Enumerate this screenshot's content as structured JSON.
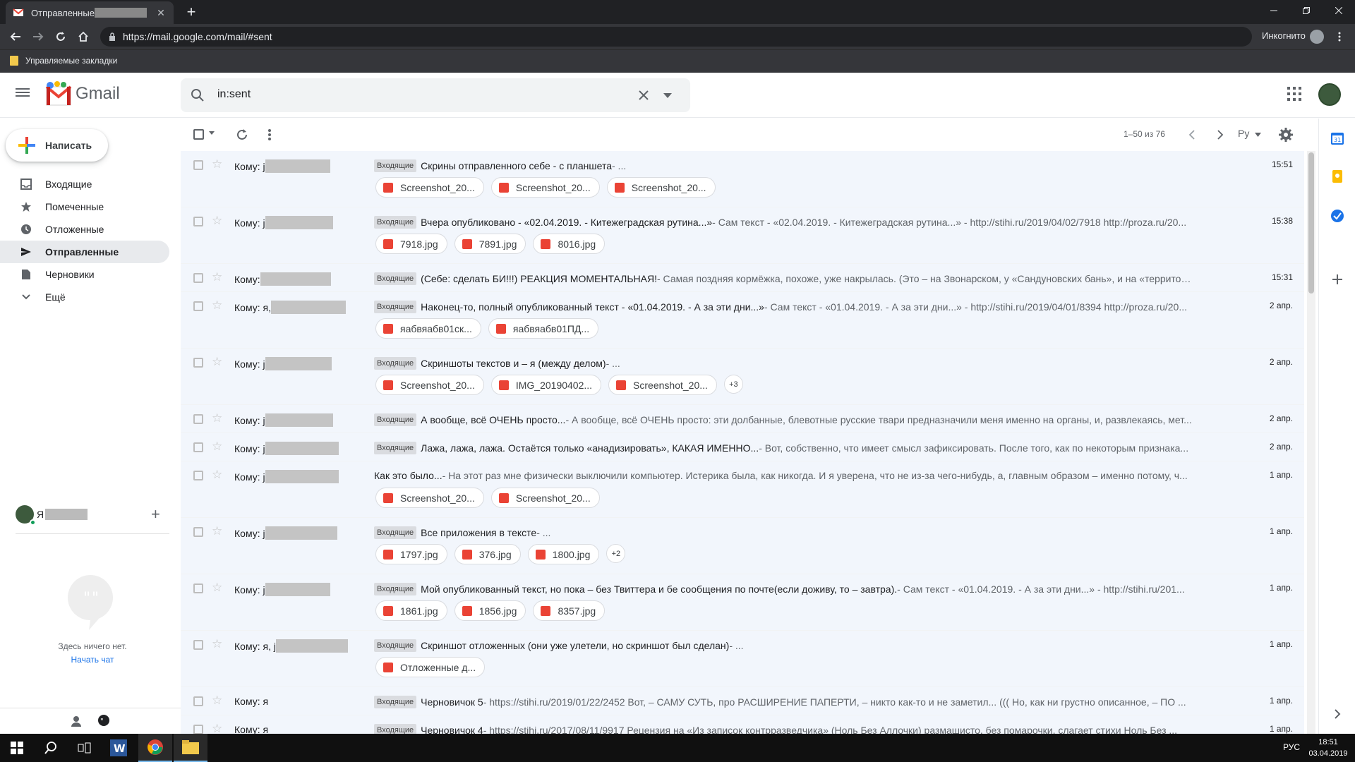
{
  "browser": {
    "tab_title": "Отправленные - j",
    "url": "https://mail.google.com/mail/#sent",
    "incognito_label": "Инкогнито",
    "bookmark_label": "Управляемые закладки"
  },
  "gmail": {
    "logo_text": "Gmail",
    "search_value": "in:sent",
    "compose_label": "Написать",
    "nav": [
      {
        "label": "Входящие",
        "icon": "inbox-icon"
      },
      {
        "label": "Помеченные",
        "icon": "star-icon"
      },
      {
        "label": "Отложенные",
        "icon": "clock-icon"
      },
      {
        "label": "Отправленные",
        "icon": "send-icon",
        "active": true
      },
      {
        "label": "Черновики",
        "icon": "draft-icon"
      },
      {
        "label": "Ещё",
        "icon": "chevron-down-icon"
      }
    ],
    "hangouts_user": "Я",
    "hangouts_empty_text": "Здесь ничего нет.",
    "hangouts_start_chat": "Начать чат",
    "pager_text": "1–50 из 76",
    "lang_label": "Ру"
  },
  "emails": [
    {
      "sender": "Кому: j",
      "label": "Входящие",
      "subject": "Скрины отправленного себе - с планшета",
      "snippet": " - ...",
      "date": "15:51",
      "attachments": [
        {
          "name": "Screenshot_20...",
          "type": "image"
        },
        {
          "name": "Screenshot_20...",
          "type": "image"
        },
        {
          "name": "Screenshot_20...",
          "type": "image"
        }
      ]
    },
    {
      "sender": "Кому: j",
      "label": "Входящие",
      "subject": "Вчера опубликовано - «02.04.2019. - Китежеградская рутина...»",
      "snippet": " - Сам текст - «02.04.2019. - Китежеградская рутина...» - http://stihi.ru/2019/04/02/7918 http://proza.ru/20...",
      "date": "15:38",
      "attachments": [
        {
          "name": "7918.jpg",
          "type": "image"
        },
        {
          "name": "7891.jpg",
          "type": "image"
        },
        {
          "name": "8016.jpg",
          "type": "image"
        }
      ]
    },
    {
      "sender": "Кому:",
      "label": "Входящие",
      "subject": "(Себе: сделать БИ!!!) РЕАКЦИЯ МОМЕНТАЛЬНАЯ!",
      "snippet": " - Самая поздняя кормёжка, похоже, уже накрылась. (Это – на Звонарском, у «Сандуновских бань», и на «территори...",
      "date": "15:31",
      "attachments": []
    },
    {
      "sender": "Кому: я,",
      "label": "Входящие",
      "subject": "Наконец-то, полный опубликованный текст - «01.04.2019. - А за эти дни...»",
      "snippet": " - Сам текст - «01.04.2019. - А за эти дни...» - http://stihi.ru/2019/04/01/8394 http://proza.ru/20...",
      "date": "2 апр.",
      "attachments": [
        {
          "name": "яабвяабв01ск...",
          "type": "image"
        },
        {
          "name": "яабвяабв01ПД...",
          "type": "pdf"
        }
      ]
    },
    {
      "sender": "Кому: j",
      "label": "Входящие",
      "subject": "Скриншоты текстов и – я (между делом)",
      "snippet": " - ...",
      "date": "2 апр.",
      "attachments": [
        {
          "name": "Screenshot_20...",
          "type": "image"
        },
        {
          "name": "IMG_20190402...",
          "type": "image"
        },
        {
          "name": "Screenshot_20...",
          "type": "image"
        }
      ],
      "more": "+3"
    },
    {
      "sender": "Кому: j",
      "label": "Входящие",
      "subject": "А вообще, всё ОЧЕНЬ просто...",
      "snippet": " - А вообще, всё ОЧЕНЬ просто: эти долбанные, блевотные русские твари предназначили меня именно на органы, и, развлекаясь, мет...",
      "date": "2 апр.",
      "attachments": []
    },
    {
      "sender": "Кому: j",
      "label": "Входящие",
      "subject": "Лажа, лажа, лажа. Остаётся только «анадизировать», КАКАЯ ИМЕННО...",
      "snippet": " - Вот, собственно, что имеет смысл зафиксировать. После того, как по некоторым признака...",
      "date": "2 апр.",
      "attachments": []
    },
    {
      "sender": "Кому: j",
      "label": "",
      "subject": "Как это было...",
      "snippet": " - На этот раз мне физически выключили компьютер. Истерика была, как никогда. И я уверена, что не из-за чего-нибудь, а, главным образом – именно потому, ч...",
      "date": "1 апр.",
      "attachments": [
        {
          "name": "Screenshot_20...",
          "type": "image"
        },
        {
          "name": "Screenshot_20...",
          "type": "image"
        }
      ]
    },
    {
      "sender": "Кому: j",
      "label": "Входящие",
      "subject": "Все приложения в тексте",
      "snippet": " - ...",
      "date": "1 апр.",
      "attachments": [
        {
          "name": "1797.jpg",
          "type": "image"
        },
        {
          "name": "376.jpg",
          "type": "image"
        },
        {
          "name": "1800.jpg",
          "type": "image"
        }
      ],
      "more": "+2"
    },
    {
      "sender": "Кому: j",
      "label": "Входящие",
      "subject": "Мой опубликованный текст, но пока – без Твиттера и бе сообщения по почте(если доживу, то – завтра).",
      "snippet": " - Сам текст - «01.04.2019. - А за эти дни...» - http://stihi.ru/201...",
      "date": "1 апр.",
      "attachments": [
        {
          "name": "1861.jpg",
          "type": "image"
        },
        {
          "name": "1856.jpg",
          "type": "image"
        },
        {
          "name": "8357.jpg",
          "type": "image"
        }
      ]
    },
    {
      "sender": "Кому: я, j",
      "label": "Входящие",
      "subject": "Скриншот отложенных (они уже улетели, но скриншот был сделан)",
      "snippet": " - ...",
      "date": "1 апр.",
      "attachments": [
        {
          "name": "Отложенные д...",
          "type": "image"
        }
      ]
    },
    {
      "sender": "Кому: я",
      "label": "Входящие",
      "subject": "Черновичок 5",
      "snippet": " - https://stihi.ru/2019/01/22/2452 Вот, – САМУ СУТЬ, про РАСШИРЕНИЕ ПАПЕРТИ, – никто как-то и не заметил... ((( Но, как ни грустно описанное, – ПО ...",
      "date": "1 апр.",
      "attachments": []
    },
    {
      "sender": "Кому: я",
      "label": "Входящие",
      "subject": "Черновичок 4",
      "snippet": " - https://stihi.ru/2017/08/11/9917 Рецензия на «Из записок контрразведчика» (Ноль Без Аллочки) размашисто, без помарочки, слагает стихи Ноль Без ...",
      "date": "1 апр.",
      "attachments": []
    }
  ],
  "taskbar": {
    "lang": "РУС",
    "time": "18:51",
    "date": "03.04.2019"
  }
}
